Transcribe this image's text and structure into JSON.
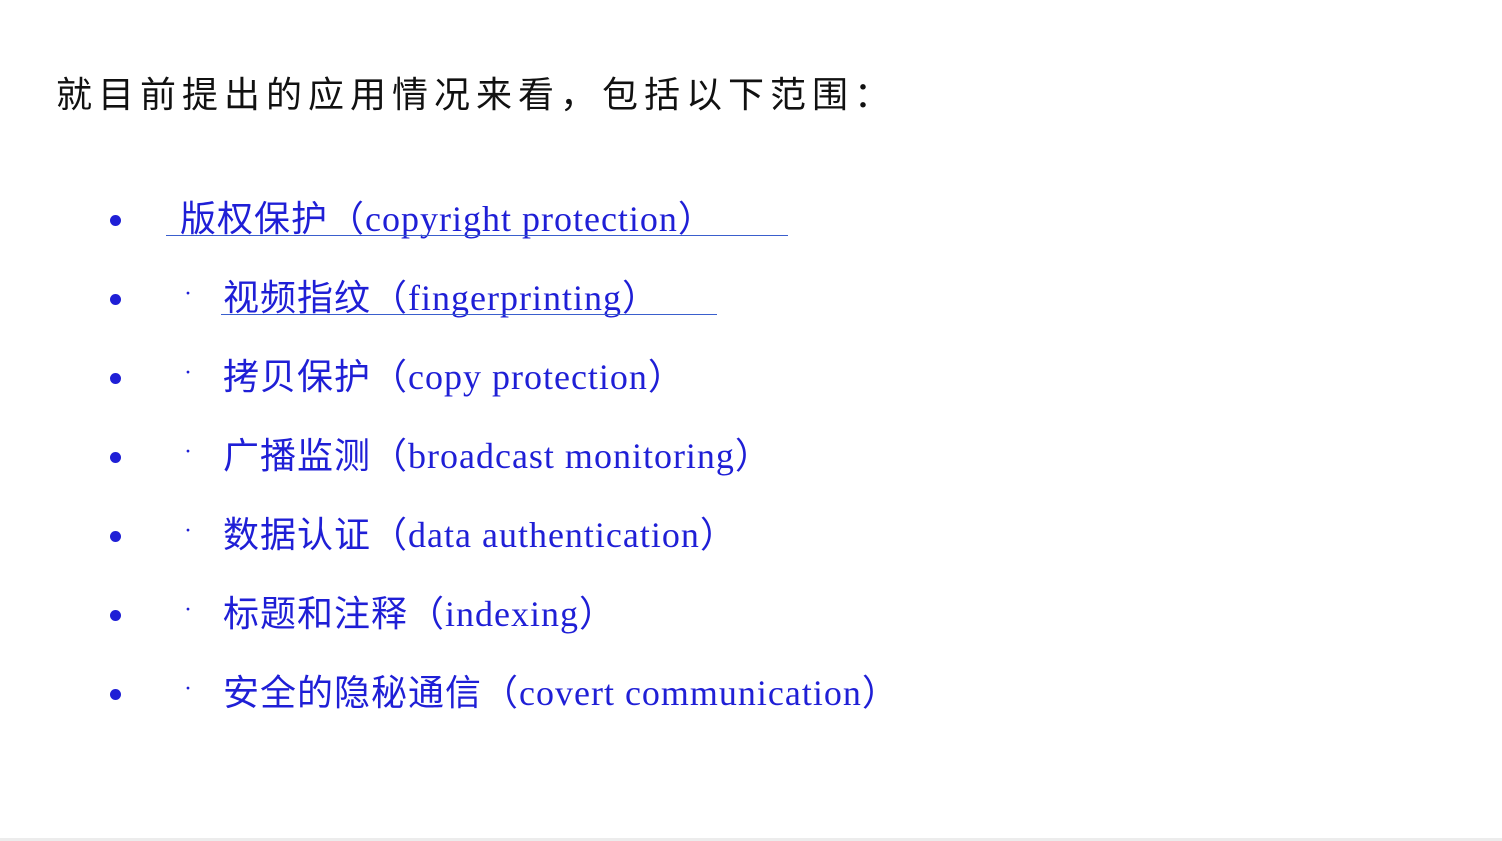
{
  "intro_text": "就目前提出的应用情况来看，包括以下范围：",
  "items": [
    {
      "label": "版权保护（copyright protection）",
      "linked": true
    },
    {
      "label": "视频指纹（fingerprinting）",
      "linked": true
    },
    {
      "label": "拷贝保护（copy protection）",
      "linked": false
    },
    {
      "label": "广播监测（broadcast monitoring）",
      "linked": false
    },
    {
      "label": "数据认证（data authentication）",
      "linked": false
    },
    {
      "label": "标题和注释（indexing）",
      "linked": false
    },
    {
      "label": "安全的隐秘通信（covert communication）",
      "linked": false
    }
  ],
  "sub_marker": "·",
  "colors": {
    "intro": "#111111",
    "list": "#1f1fd6",
    "link_underline": "#3a5fcd"
  }
}
